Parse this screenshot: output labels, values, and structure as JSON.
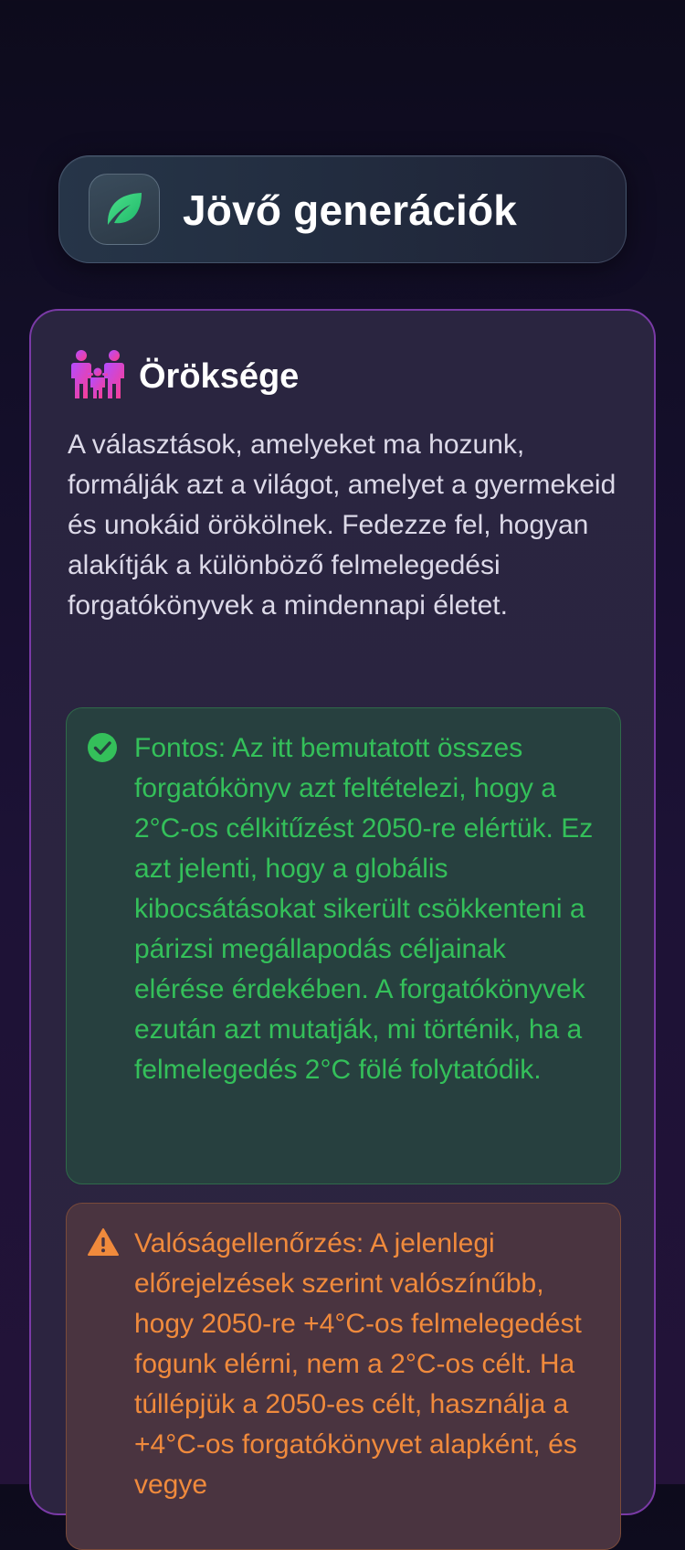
{
  "header": {
    "title": "Jövő generációk",
    "icon": "leaf-icon",
    "accent_color": "#2ecc71"
  },
  "card": {
    "title": "Öröksége",
    "icon": "family-icon",
    "description": "A választások, amelyeket ma hozunk, formálják azt a világot, amelyet a gyermekeid és unokáid örökölnek. Fedezze fel, hogyan alakítják a különböző felmelegedési forgatókönyvek a mindennapi életet.",
    "border_color": "#7a3aa6"
  },
  "notices": {
    "success": {
      "icon": "check-circle-icon",
      "color": "#34c05a",
      "text": "Fontos: Az itt bemutatott összes forgatókönyv azt feltételezi, hogy a 2°C-os célkitűzést 2050-re elértük. Ez azt jelenti, hogy a globális kibocsátásokat sikerült csökkenteni a párizsi megállapodás céljainak elérése érdekében. A forgatókönyvek ezután azt mutatják, mi történik, ha a felmelegedés 2°C fölé folytatódik."
    },
    "warning": {
      "icon": "warning-triangle-icon",
      "color": "#f08a3c",
      "text": "Valóságellenőrzés: A jelenlegi előrejelzések szerint valószínűbb, hogy 2050-re +4°C-os felmelegedést fogunk elérni, nem a 2°C-os célt. Ha túllépjük a 2050-es célt, használja a +4°C-os forgatókönyvet alapként, és vegye"
    }
  }
}
